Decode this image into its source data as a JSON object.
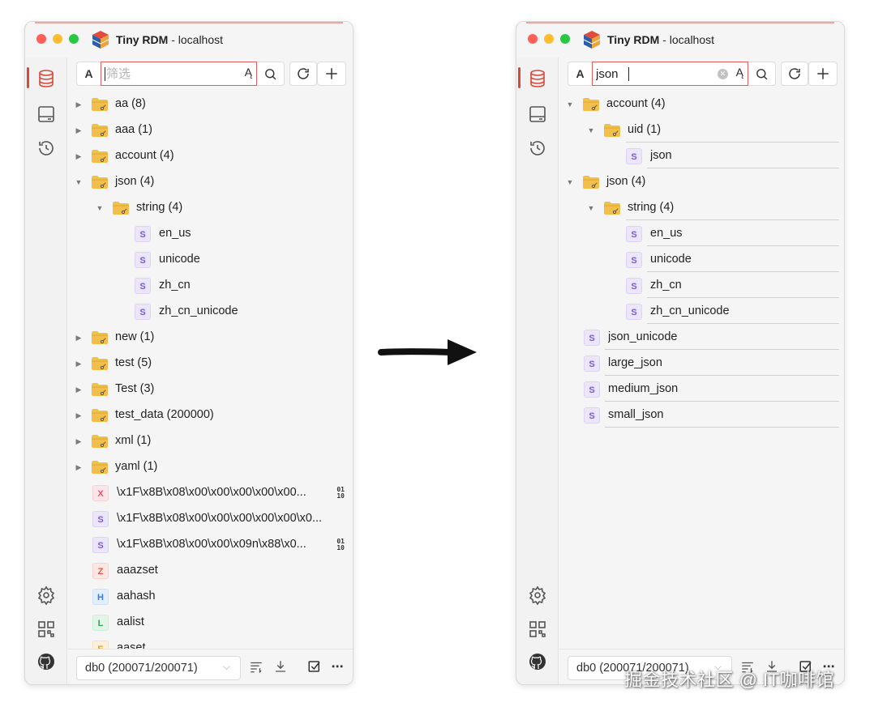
{
  "windows": [
    {
      "title_app": "Tiny RDM",
      "title_sep": " - ",
      "title_host": "localhost",
      "toolbar": {
        "case_label": "A",
        "filter_value": "",
        "filter_placeholder": "筛选",
        "spell_icon": "Ą"
      },
      "tree": [
        {
          "kind": "folder",
          "label": "aa (8)",
          "depth": 0,
          "expanded": false
        },
        {
          "kind": "folder",
          "label": "aaa (1)",
          "depth": 0,
          "expanded": false
        },
        {
          "kind": "folder",
          "label": "account (4)",
          "depth": 0,
          "expanded": false
        },
        {
          "kind": "folder",
          "label": "json (4)",
          "depth": 0,
          "expanded": true
        },
        {
          "kind": "folder",
          "label": "string (4)",
          "depth": 1,
          "expanded": true
        },
        {
          "kind": "key",
          "type": "S",
          "label": "en_us",
          "depth": 2
        },
        {
          "kind": "key",
          "type": "S",
          "label": "unicode",
          "depth": 2
        },
        {
          "kind": "key",
          "type": "S",
          "label": "zh_cn",
          "depth": 2
        },
        {
          "kind": "key",
          "type": "S",
          "label": "zh_cn_unicode",
          "depth": 2
        },
        {
          "kind": "folder",
          "label": "new (1)",
          "depth": 0,
          "expanded": false
        },
        {
          "kind": "folder",
          "label": "test (5)",
          "depth": 0,
          "expanded": false
        },
        {
          "kind": "folder",
          "label": "Test (3)",
          "depth": 0,
          "expanded": false
        },
        {
          "kind": "folder",
          "label": "test_data (200000)",
          "depth": 0,
          "expanded": false
        },
        {
          "kind": "folder",
          "label": "xml (1)",
          "depth": 0,
          "expanded": false
        },
        {
          "kind": "folder",
          "label": "yaml (1)",
          "depth": 0,
          "expanded": false
        },
        {
          "kind": "key",
          "type": "X",
          "label": "\\x1F\\x8B\\x08\\x00\\x00\\x00\\x00\\x00...",
          "depth": 0,
          "binary": true
        },
        {
          "kind": "key",
          "type": "S",
          "label": "\\x1F\\x8B\\x08\\x00\\x00\\x00\\x00\\x00\\x0...",
          "depth": 0
        },
        {
          "kind": "key",
          "type": "S",
          "label": "\\x1F\\x8B\\x08\\x00\\x00\\x09n\\x88\\x0...",
          "depth": 0,
          "binary": true
        },
        {
          "kind": "key",
          "type": "Z",
          "label": "aaazset",
          "depth": 0
        },
        {
          "kind": "key",
          "type": "H",
          "label": "aahash",
          "depth": 0
        },
        {
          "kind": "key",
          "type": "L",
          "label": "aalist",
          "depth": 0
        },
        {
          "kind": "key",
          "type": "E",
          "label": "aaset",
          "depth": 0
        }
      ],
      "status": {
        "db_label": "db0 (200071/200071)"
      }
    },
    {
      "title_app": "Tiny RDM",
      "title_sep": " - ",
      "title_host": "localhost",
      "toolbar": {
        "case_label": "A",
        "filter_value": "json",
        "filter_placeholder": "",
        "spell_icon": "Ą"
      },
      "tree": [
        {
          "kind": "folder",
          "label": "account (4)",
          "depth": 0,
          "expanded": true
        },
        {
          "kind": "folder",
          "label": "uid (1)",
          "depth": 1,
          "expanded": true
        },
        {
          "kind": "key",
          "type": "S",
          "label": "json",
          "depth": 2
        },
        {
          "kind": "folder",
          "label": "json (4)",
          "depth": 0,
          "expanded": true
        },
        {
          "kind": "folder",
          "label": "string (4)",
          "depth": 1,
          "expanded": true
        },
        {
          "kind": "key",
          "type": "S",
          "label": "en_us",
          "depth": 2
        },
        {
          "kind": "key",
          "type": "S",
          "label": "unicode",
          "depth": 2
        },
        {
          "kind": "key",
          "type": "S",
          "label": "zh_cn",
          "depth": 2
        },
        {
          "kind": "key",
          "type": "S",
          "label": "zh_cn_unicode",
          "depth": 2
        },
        {
          "kind": "key",
          "type": "S",
          "label": "json_unicode",
          "depth": 0
        },
        {
          "kind": "key",
          "type": "S",
          "label": "large_json",
          "depth": 0
        },
        {
          "kind": "key",
          "type": "S",
          "label": "medium_json",
          "depth": 0
        },
        {
          "kind": "key",
          "type": "S",
          "label": "small_json",
          "depth": 0
        }
      ],
      "status": {
        "db_label": "db0 (200071/200071)"
      }
    }
  ],
  "icons": {
    "sidebar": [
      "database-icon",
      "terminal-icon",
      "history-icon",
      "settings-icon",
      "grid-icon",
      "github-icon"
    ],
    "toolbar": [
      "search-icon",
      "refresh-icon",
      "plus-icon"
    ],
    "status": [
      "filter-list-icon",
      "download-icon",
      "checkbox-icon",
      "more-icon"
    ]
  },
  "colors": {
    "accent_red": "#d64a3a",
    "folder_yellow": "#f2c04a",
    "type_string": "#7a5ad8",
    "type_stream": "#e0546a",
    "type_zset": "#e05a46",
    "type_hash": "#3c7ae0",
    "type_list": "#3aa35a",
    "type_set": "#e0a137"
  },
  "watermark": "掘金技术社区 @ IT咖啡馆"
}
